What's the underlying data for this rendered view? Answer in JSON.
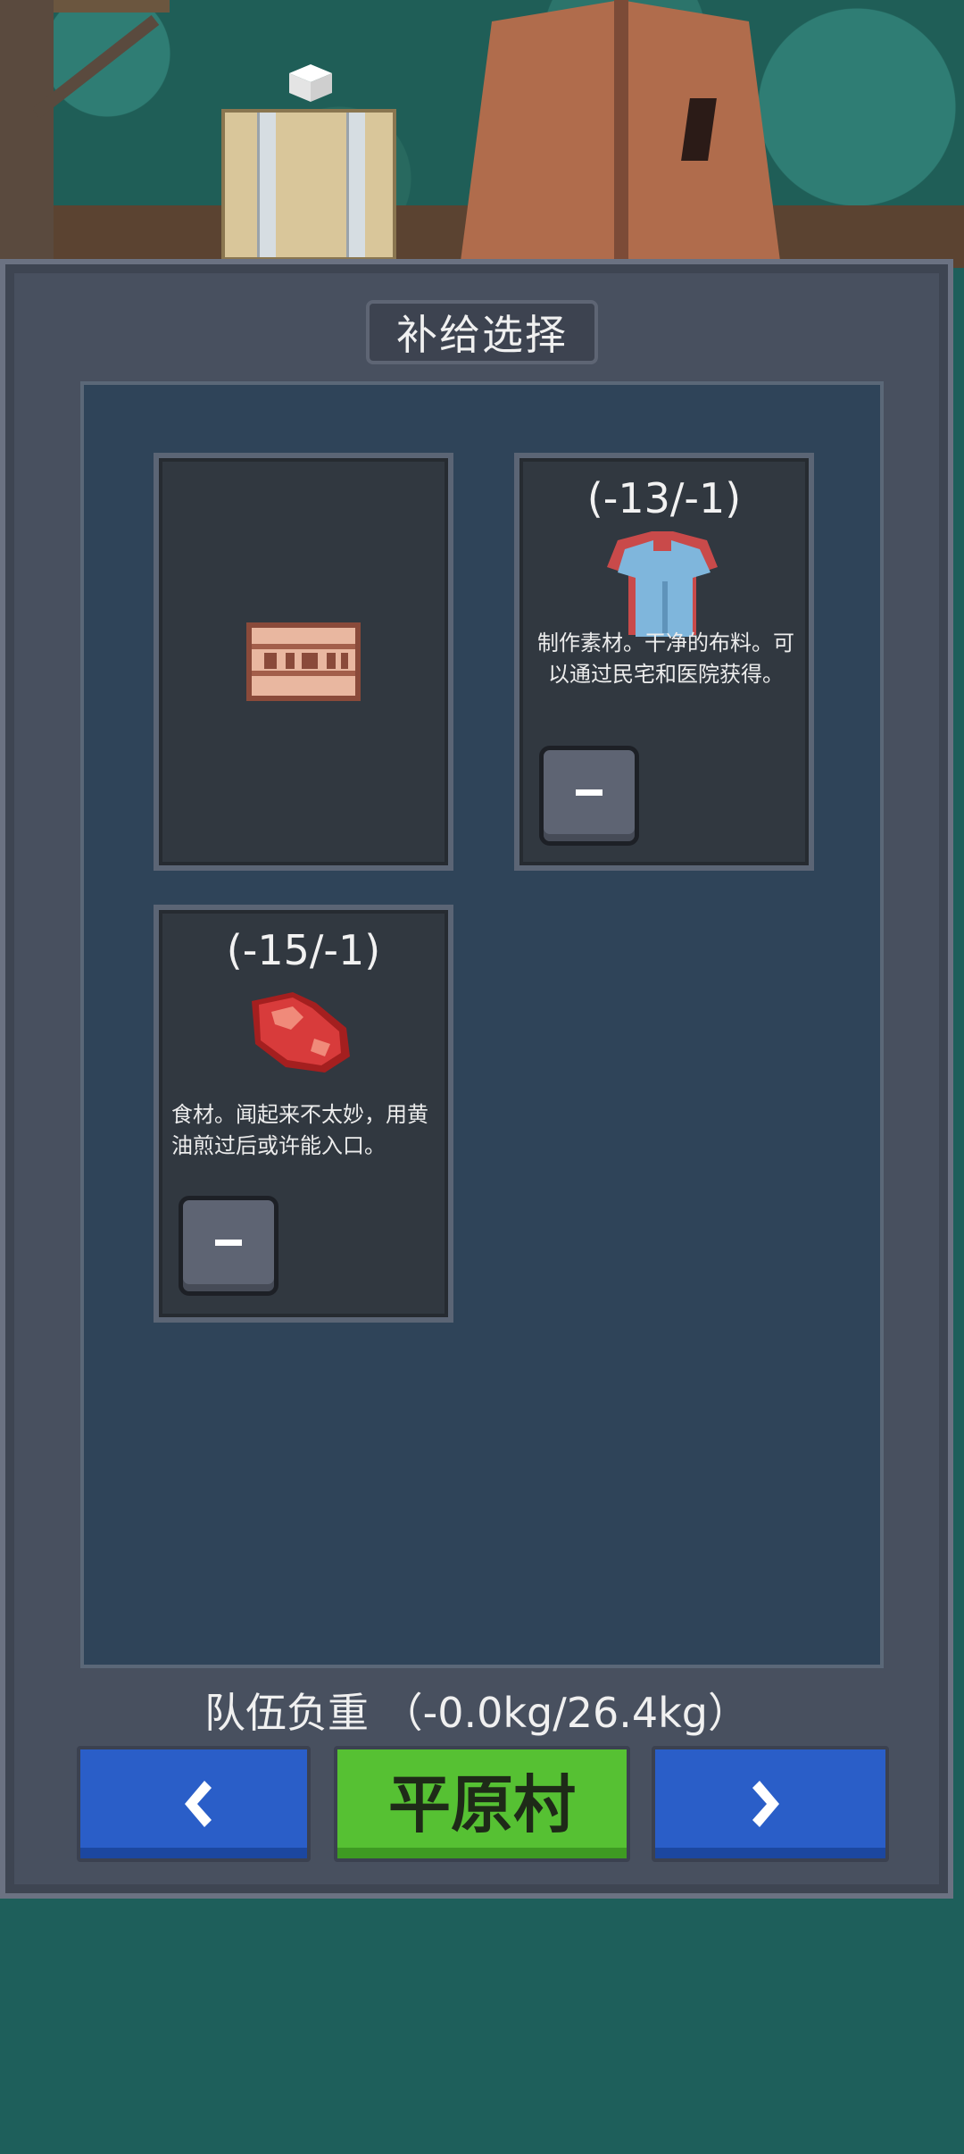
{
  "header": {
    "title": "补给选择"
  },
  "items": [
    {
      "count": "",
      "description": "",
      "icon": "wooden-sign-icon",
      "has_minus": false
    },
    {
      "count": "(-13/-1)",
      "description": "制作素材。干净的布料。可以通过民宅和医院获得。",
      "icon": "cloth-shirt-icon",
      "has_minus": true
    },
    {
      "count": "(-15/-1)",
      "description": "食材。闻起来不太妙，用黄油煎过后或许能入口。",
      "icon": "raw-meat-icon",
      "has_minus": true
    }
  ],
  "footer": {
    "weight_text": "队伍负重 （-0.0kg/26.4kg）",
    "prev_icon": "chevron-left-icon",
    "location_label": "平原村",
    "next_icon": "chevron-right-icon"
  },
  "colors": {
    "panel": "#48505f",
    "inner": "#2f4459",
    "card": "#313840",
    "nav_blue": "#2a5ec8",
    "nav_green": "#56c133"
  }
}
